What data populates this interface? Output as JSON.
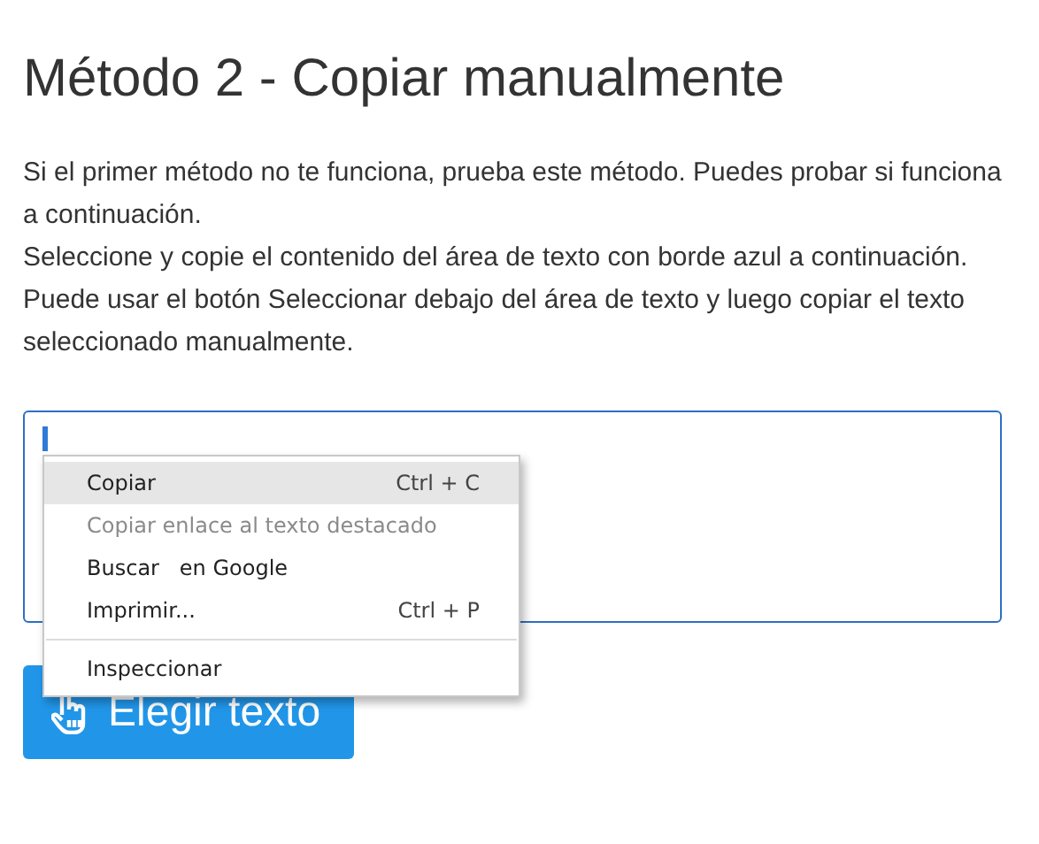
{
  "title": "Método 2 - Copiar manualmente",
  "paragraphs": [
    "Si el primer método no te funciona, prueba este método. Puedes probar si funciona a continuación.",
    "Seleccione y copie el contenido del área de texto con borde azul a continuación.",
    "Puede usar el botón Seleccionar debajo del área de texto y luego copiar el texto seleccionado manualmente."
  ],
  "text_area": {
    "focused": true
  },
  "button": {
    "label": "Elegir texto"
  },
  "context_menu": [
    {
      "kind": "item",
      "label": "Copiar",
      "shortcut": "Ctrl + C",
      "selected": true,
      "disabled": false
    },
    {
      "kind": "item",
      "label": "Copiar enlace al texto destacado",
      "selected": false,
      "disabled": true
    },
    {
      "kind": "item",
      "label": "Buscar   en Google",
      "selected": false,
      "disabled": false
    },
    {
      "kind": "item",
      "label": "Imprimir...",
      "shortcut": "Ctrl + P",
      "selected": false,
      "disabled": false
    },
    {
      "kind": "separator"
    },
    {
      "kind": "item",
      "label": "Inspeccionar",
      "selected": false,
      "disabled": false
    }
  ]
}
